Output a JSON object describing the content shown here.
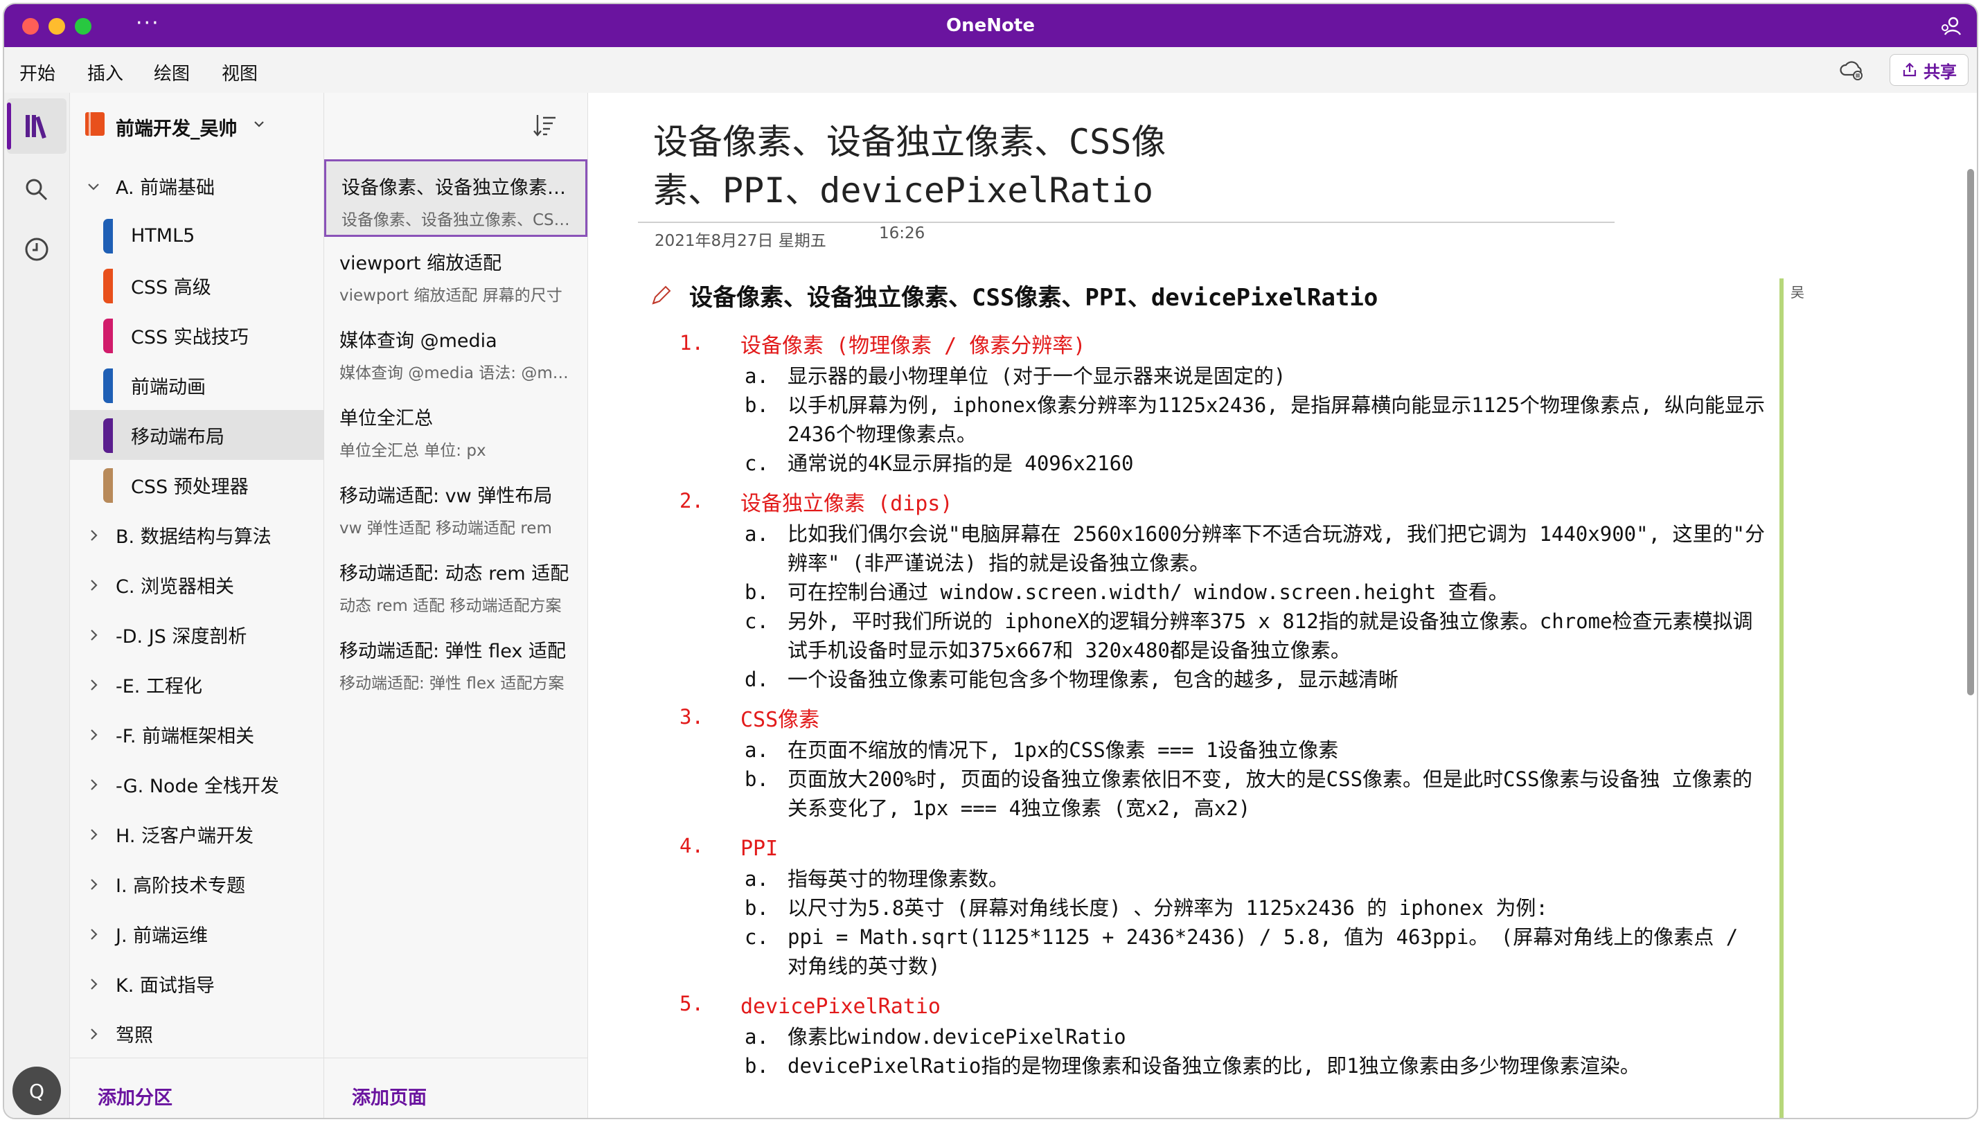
{
  "app": {
    "title": "OneNote",
    "dots": "···"
  },
  "menu": {
    "items": [
      "开始",
      "插入",
      "绘图",
      "视图"
    ],
    "share": "共享"
  },
  "notebook": {
    "name": "前端开发_吴帅",
    "sections": [
      {
        "type": "group",
        "label": "A. 前端基础",
        "expanded": true
      },
      {
        "type": "section",
        "label": "HTML5",
        "color": "#1f5fb5"
      },
      {
        "type": "section",
        "label": "CSS 高级",
        "color": "#e8501c"
      },
      {
        "type": "section",
        "label": "CSS 实战技巧",
        "color": "#d11c6b"
      },
      {
        "type": "section",
        "label": "前端动画",
        "color": "#1f5fb5"
      },
      {
        "type": "section",
        "label": "移动端布局",
        "color": "#5a1e8e",
        "selected": true
      },
      {
        "type": "section",
        "label": "CSS 预处理器",
        "color": "#b88a5a"
      },
      {
        "type": "group",
        "label": "B. 数据结构与算法"
      },
      {
        "type": "group",
        "label": "C. 浏览器相关"
      },
      {
        "type": "group",
        "label": "-D. JS 深度剖析"
      },
      {
        "type": "group",
        "label": "-E. 工程化"
      },
      {
        "type": "group",
        "label": "-F. 前端框架相关"
      },
      {
        "type": "group",
        "label": "-G. Node 全栈开发"
      },
      {
        "type": "group",
        "label": "H. 泛客户端开发"
      },
      {
        "type": "group",
        "label": "I. 高阶技术专题"
      },
      {
        "type": "group",
        "label": "J. 前端运维"
      },
      {
        "type": "group",
        "label": "K. 面试指导"
      },
      {
        "type": "group",
        "label": "驾照"
      }
    ],
    "add_section": "添加分区"
  },
  "pages": {
    "items": [
      {
        "title": "设备像素、设备独立像素、CSS像素、PPI、devicePixelRatio",
        "sub": "设备像素、设备独立像素、CSS像素",
        "selected": true
      },
      {
        "title": "viewport 缩放适配",
        "sub": "viewport 缩放适配  屏幕的尺寸"
      },
      {
        "title": "媒体查询 @media",
        "sub": "媒体查询 @media  语法: @media"
      },
      {
        "title": "单位全汇总",
        "sub": "单位全汇总  单位:   px"
      },
      {
        "title": "移动端适配: vw 弹性布局",
        "sub": "vw 弹性适配  移动端适配 rem"
      },
      {
        "title": "移动端适配: 动态 rem 适配",
        "sub": "动态 rem 适配  移动端适配方案"
      },
      {
        "title": "移动端适配: 弹性 flex 适配",
        "sub": "移动端适配: 弹性 flex 适配方案"
      }
    ],
    "add_page": "添加页面"
  },
  "page": {
    "title": "设备像素、设备独立像素、CSS像素、PPI、devicePixelRatio",
    "date": "2021年8月27日 星期五",
    "time": "16:26",
    "author": "吴",
    "heading": "设备像素、设备独立像素、CSS像素、PPI、devicePixelRatio",
    "items": [
      {
        "num": "1.",
        "head": "设备像素 (物理像素 / 像素分辨率)",
        "subs": [
          {
            "letter": "a.",
            "text": "显示器的最小物理单位 (对于一个显示器来说是固定的)"
          },
          {
            "letter": "b.",
            "text": "以手机屏幕为例, iphonex像素分辨率为1125x2436, 是指屏幕横向能显示1125个物理像素点, 纵向能显示2436个物理像素点。"
          },
          {
            "letter": "c.",
            "text": "通常说的4K显示屏指的是 4096x2160"
          }
        ]
      },
      {
        "num": "2.",
        "head": "设备独立像素 (dips)",
        "subs": [
          {
            "letter": "a.",
            "text": "比如我们偶尔会说\"电脑屏幕在 2560x1600分辨率下不适合玩游戏, 我们把它调为 1440x900\", 这里的\"分辨率\" (非严谨说法) 指的就是设备独立像素。"
          },
          {
            "letter": "b.",
            "text": "可在控制台通过 window.screen.width/ window.screen.height 查看。"
          },
          {
            "letter": "c.",
            "text": "另外, 平时我们所说的 iphoneX的逻辑分辨率375 x 812指的就是设备独立像素。chrome检查元素模拟调试手机设备时显示如375x667和 320x480都是设备独立像素。"
          },
          {
            "letter": "d.",
            "text": "一个设备独立像素可能包含多个物理像素, 包含的越多, 显示越清晰"
          }
        ]
      },
      {
        "num": "3.",
        "head": "CSS像素",
        "subs": [
          {
            "letter": "a.",
            "text": "在页面不缩放的情况下, 1px的CSS像素 === 1设备独立像素"
          },
          {
            "letter": "b.",
            "text": "页面放大200%时, 页面的设备独立像素依旧不变, 放大的是CSS像素。但是此时CSS像素与设备独 立像素的关系变化了, 1px === 4独立像素 (宽x2, 高x2)"
          }
        ]
      },
      {
        "num": "4.",
        "head": "PPI",
        "subs": [
          {
            "letter": "a.",
            "text": "指每英寸的物理像素数。"
          },
          {
            "letter": "b.",
            "text": "以尺寸为5.8英寸 (屏幕对角线长度) 、分辨率为 1125x2436 的 iphonex 为例:"
          },
          {
            "letter": "c.",
            "text": "ppi = Math.sqrt(1125*1125 + 2436*2436) / 5.8, 值为 463ppi。 (屏幕对角线上的像素点 / 对角线的英寸数)"
          }
        ]
      },
      {
        "num": "5.",
        "head": "devicePixelRatio",
        "subs": [
          {
            "letter": "a.",
            "text": "像素比window.devicePixelRatio"
          },
          {
            "letter": "b.",
            "text": "devicePixelRatio指的是物理像素和设备独立像素的比, 即1独立像素由多少物理像素渲染。"
          }
        ]
      }
    ]
  },
  "user": {
    "initial": "Q"
  },
  "colors": {
    "brand": "#6a149f",
    "accent_red": "#e21a1a"
  }
}
